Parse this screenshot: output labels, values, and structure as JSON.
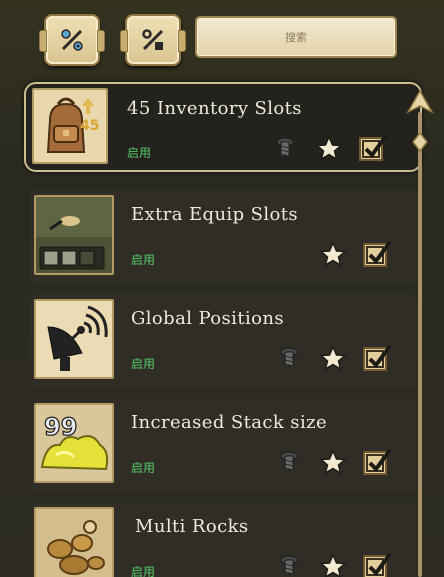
{
  "search": {
    "placeholder": "搜索"
  },
  "filters": [
    {
      "icon": "config-filter-icon"
    },
    {
      "icon": "percent-filter-icon"
    }
  ],
  "mods": [
    {
      "title": "45 Inventory Slots",
      "status": "启用",
      "selected": true,
      "icon": "backpack-icon",
      "badge": "45"
    },
    {
      "title": "Extra Equip Slots",
      "status": "启用",
      "selected": false,
      "icon": "equip-slots-icon"
    },
    {
      "title": "Global Positions",
      "status": "启用",
      "selected": false,
      "icon": "satellite-dish-icon"
    },
    {
      "title": "Increased Stack size",
      "status": "启用",
      "selected": false,
      "icon": "gold-stack-icon",
      "badge": "99"
    },
    {
      "title": "Multi Rocks",
      "status": "启用",
      "selected": false,
      "icon": "rocks-icon"
    }
  ],
  "colors": {
    "status": "#58c96a",
    "title": "#eeeadb",
    "accent": "#e2cf9c"
  }
}
